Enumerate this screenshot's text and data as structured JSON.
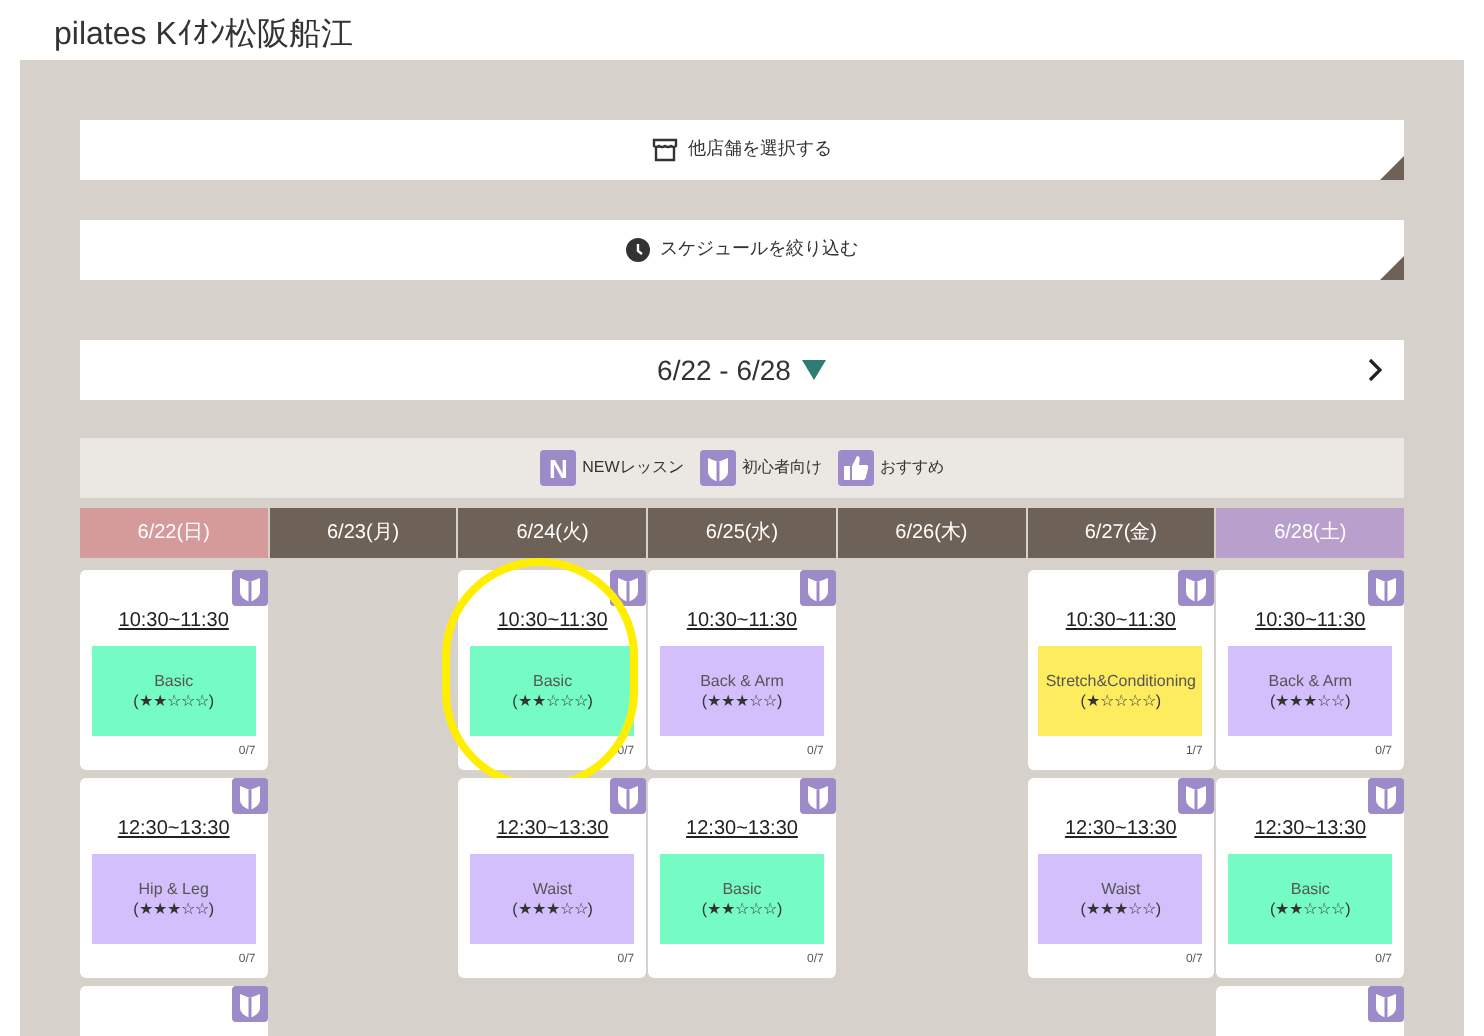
{
  "title": "pilates Kｲｵﾝ松阪船江",
  "store_button": {
    "label": "他店舗を選択する"
  },
  "filter_button": {
    "label": "スケジュールを絞り込む"
  },
  "week_nav": {
    "range": "6/22 - 6/28"
  },
  "legend": [
    {
      "kind": "new",
      "glyph": "N",
      "label": "NEWレッスン"
    },
    {
      "kind": "beginner",
      "label": "初心者向け"
    },
    {
      "kind": "recommended",
      "label": "おすすめ"
    }
  ],
  "days": [
    {
      "label": "6/22(日)",
      "kind": "sunday",
      "lessons": [
        {
          "beginner": true,
          "time": "10:30~11:30",
          "name": "Basic",
          "rating": "(★★☆☆☆)",
          "color": "#75fcc4",
          "count": "0/7"
        },
        {
          "beginner": true,
          "time": "12:30~13:30",
          "name": "Hip & Leg",
          "rating": "(★★★☆☆)",
          "color": "#d2bffc",
          "count": "0/7"
        },
        {
          "beginner": true
        }
      ]
    },
    {
      "label": "6/23(月)",
      "kind": "weekday"
    },
    {
      "label": "6/24(火)",
      "kind": "weekday",
      "lessons": [
        {
          "beginner": true,
          "time": "10:30~11:30",
          "name": "Basic",
          "rating": "(★★☆☆☆)",
          "color": "#75fcc4",
          "count": "0/7",
          "highlighted": true
        },
        {
          "beginner": true,
          "time": "12:30~13:30",
          "name": "Waist",
          "rating": "(★★★☆☆)",
          "color": "#d2bffc",
          "count": "0/7"
        }
      ]
    },
    {
      "label": "6/25(水)",
      "kind": "weekday",
      "lessons": [
        {
          "beginner": true,
          "time": "10:30~11:30",
          "name": "Back & Arm",
          "rating": "(★★★☆☆)",
          "color": "#d2bffc",
          "count": "0/7"
        },
        {
          "beginner": true,
          "time": "12:30~13:30",
          "name": "Basic",
          "rating": "(★★☆☆☆)",
          "color": "#75fcc4",
          "count": "0/7"
        }
      ]
    },
    {
      "label": "6/26(木)",
      "kind": "weekday"
    },
    {
      "label": "6/27(金)",
      "kind": "weekday",
      "lessons": [
        {
          "beginner": true,
          "time": "10:30~11:30",
          "name": "Stretch&Conditioning",
          "rating": "(★☆☆☆☆)",
          "color": "#fdec5e",
          "count": "1/7"
        },
        {
          "beginner": true,
          "time": "12:30~13:30",
          "name": "Waist",
          "rating": "(★★★☆☆)",
          "color": "#d2bffc",
          "count": "0/7"
        }
      ]
    },
    {
      "label": "6/28(土)",
      "kind": "saturday",
      "lessons": [
        {
          "beginner": true,
          "time": "10:30~11:30",
          "name": "Back & Arm",
          "rating": "(★★★☆☆)",
          "color": "#d2bffc",
          "count": "0/7"
        },
        {
          "beginner": true,
          "time": "12:30~13:30",
          "name": "Basic",
          "rating": "(★★☆☆☆)",
          "color": "#75fcc4",
          "count": "0/7"
        },
        {
          "beginner": true
        }
      ]
    }
  ]
}
